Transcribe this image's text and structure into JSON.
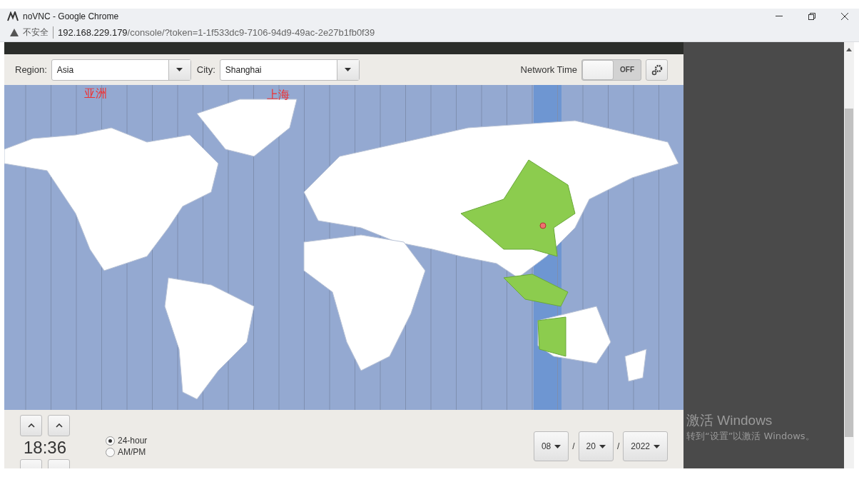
{
  "window": {
    "title": "noVNC - Google Chrome"
  },
  "address_bar": {
    "security": "不安全",
    "url_host": "192.168.229.179",
    "url_path": "/console/?token=1-1f533dc9-7106-94d9-49ac-2e27b1fb0f39"
  },
  "timezone": {
    "region_label": "Region:",
    "region": "Asia",
    "city_label": "City:",
    "city": "Shanghai",
    "network_time_label": "Network Time",
    "network_time": {
      "on": false,
      "label": "OFF"
    }
  },
  "annotations": [
    {
      "text": "亚洲"
    },
    {
      "text": "上海"
    }
  ],
  "clock": {
    "time": "18:36",
    "formats": [
      {
        "label": "24-hour",
        "selected": true
      },
      {
        "label": "AM/PM",
        "selected": false
      }
    ]
  },
  "date": {
    "month": "08",
    "day": "20",
    "year": "2022",
    "separators": [
      "/",
      "/"
    ]
  },
  "activation_notice": {
    "title": "激活 Windows",
    "text": "转到“设置”以激活 Windows。"
  }
}
